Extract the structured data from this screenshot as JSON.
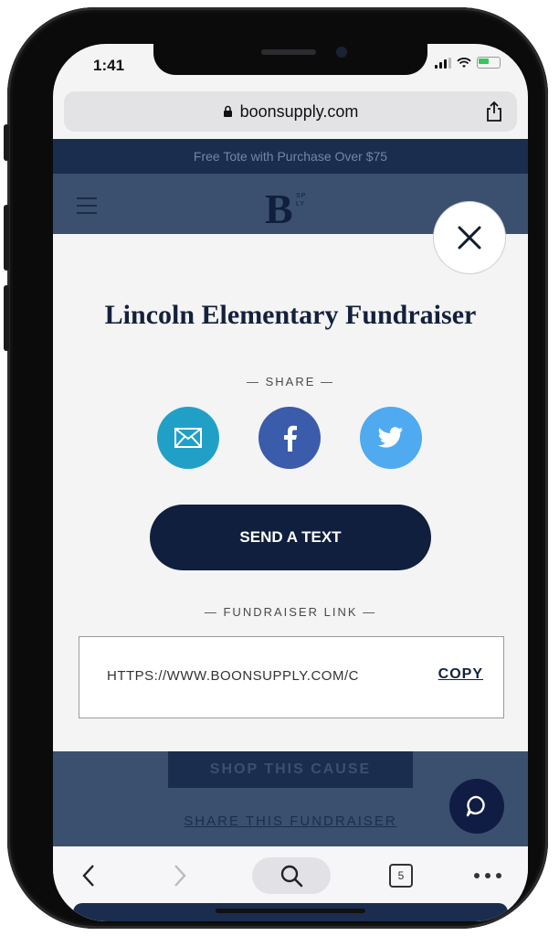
{
  "status_bar": {
    "time": "1:41"
  },
  "browser": {
    "url": "boonsupply.com",
    "tab_count": "5"
  },
  "site": {
    "promo_text": "Free Tote with Purchase Over $75",
    "logo": "B",
    "logo_small_top": "SP",
    "logo_small_bottom": "LY"
  },
  "modal": {
    "title": "Lincoln Elementary Fundraiser",
    "share_label": "— SHARE —",
    "send_text_label": "SEND A TEXT",
    "link_label": "— FUNDRAISER LINK —",
    "link_value": "HTTPS://WWW.BOONSUPPLY.COM/C",
    "copy_label": "COPY"
  },
  "page_below": {
    "shop_button": "SHOP THIS CAUSE",
    "share_link": "SHARE THIS FUNDRAISER"
  },
  "colors": {
    "navy": "#0f1f3d",
    "email_circle": "#21a0c7",
    "facebook_circle": "#3b5bab",
    "twitter_circle": "#4faaf0"
  }
}
